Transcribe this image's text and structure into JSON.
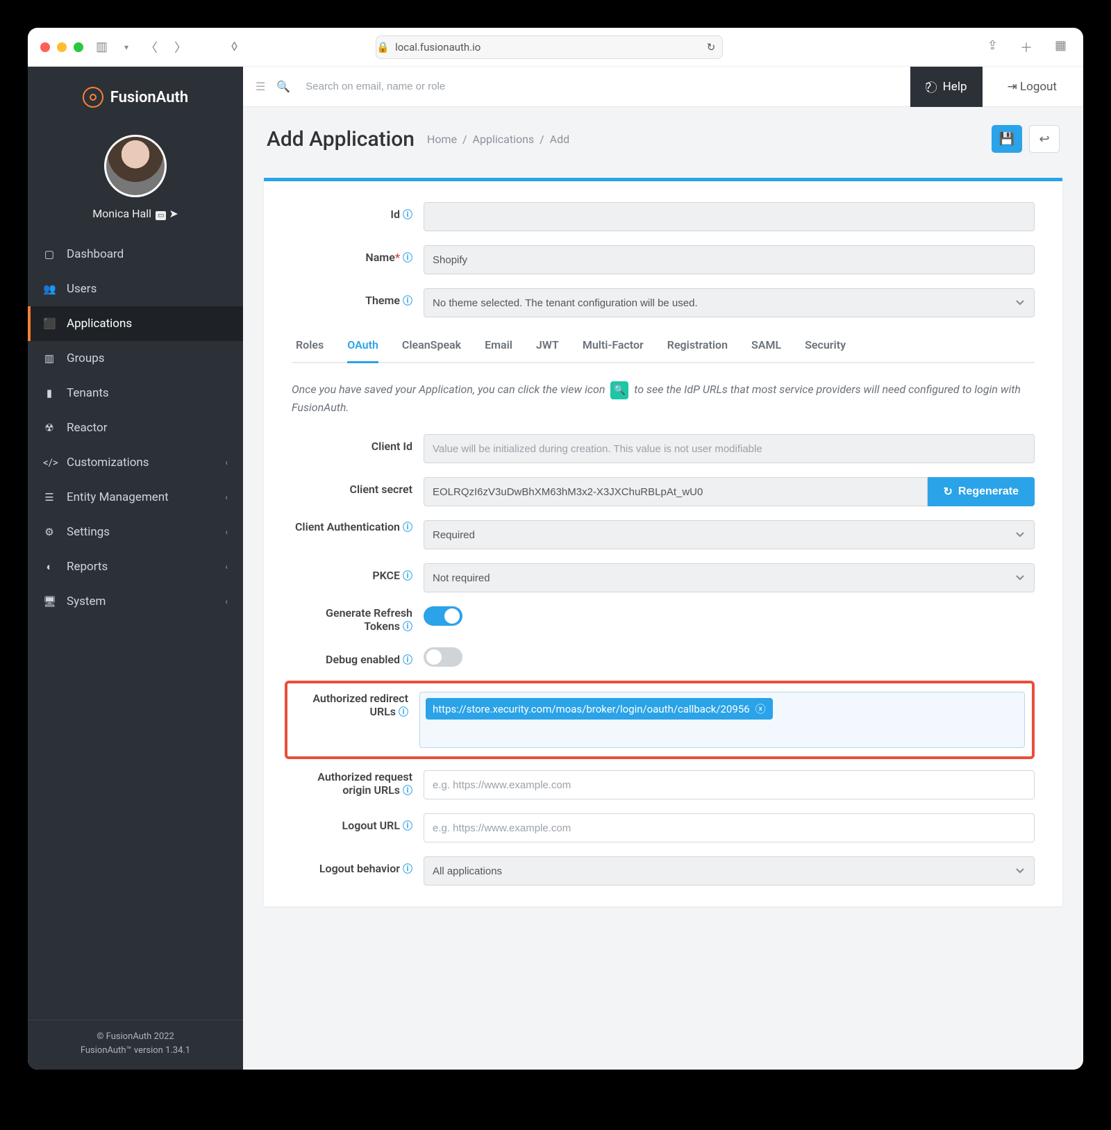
{
  "browser": {
    "url": "local.fusionauth.io"
  },
  "brand": "FusionAuth",
  "user": {
    "name": "Monica Hall"
  },
  "sidebar": {
    "items": [
      {
        "label": "Dashboard"
      },
      {
        "label": "Users"
      },
      {
        "label": "Applications",
        "active": true
      },
      {
        "label": "Groups"
      },
      {
        "label": "Tenants"
      },
      {
        "label": "Reactor"
      },
      {
        "label": "Customizations",
        "expandable": true
      },
      {
        "label": "Entity Management",
        "expandable": true
      },
      {
        "label": "Settings",
        "expandable": true
      },
      {
        "label": "Reports",
        "expandable": true
      },
      {
        "label": "System",
        "expandable": true
      }
    ]
  },
  "footer": {
    "copyright": "© FusionAuth 2022",
    "version": "FusionAuth™ version 1.34.1"
  },
  "topbar": {
    "search_placeholder": "Search on email, name or role",
    "help": "Help",
    "logout": "Logout"
  },
  "page": {
    "title": "Add Application",
    "crumbs": [
      "Home",
      "Applications",
      "Add"
    ]
  },
  "form": {
    "id_label": "Id",
    "name_label": "Name",
    "name_value": "Shopify",
    "theme_label": "Theme",
    "theme_value": "No theme selected. The tenant configuration will be used."
  },
  "tabs": [
    "Roles",
    "OAuth",
    "CleanSpeak",
    "Email",
    "JWT",
    "Multi-Factor",
    "Registration",
    "SAML",
    "Security"
  ],
  "active_tab": "OAuth",
  "oauth": {
    "note_prefix": "Once you have saved your Application, you can click the view icon",
    "note_suffix": "to see the IdP URLs that most service providers will need configured to login with FusionAuth.",
    "client_id_label": "Client Id",
    "client_id_placeholder": "Value will be initialized during creation. This value is not user modifiable",
    "client_secret_label": "Client secret",
    "client_secret_value": "EOLRQzI6zV3uDwBhXM63hM3x2-X3JXChuRBLpAt_wU0",
    "regenerate": "Regenerate",
    "client_auth_label": "Client Authentication",
    "client_auth_value": "Required",
    "pkce_label": "PKCE",
    "pkce_value": "Not required",
    "refresh_label": "Generate Refresh Tokens",
    "debug_label": "Debug enabled",
    "redirect_label": "Authorized redirect URLs",
    "redirect_chip": "https://store.xecurity.com/moas/broker/login/oauth/callback/20956",
    "origin_label": "Authorized request origin URLs",
    "origin_placeholder": "e.g. https://www.example.com",
    "logout_url_label": "Logout URL",
    "logout_url_placeholder": "e.g. https://www.example.com",
    "logout_behavior_label": "Logout behavior",
    "logout_behavior_value": "All applications"
  }
}
